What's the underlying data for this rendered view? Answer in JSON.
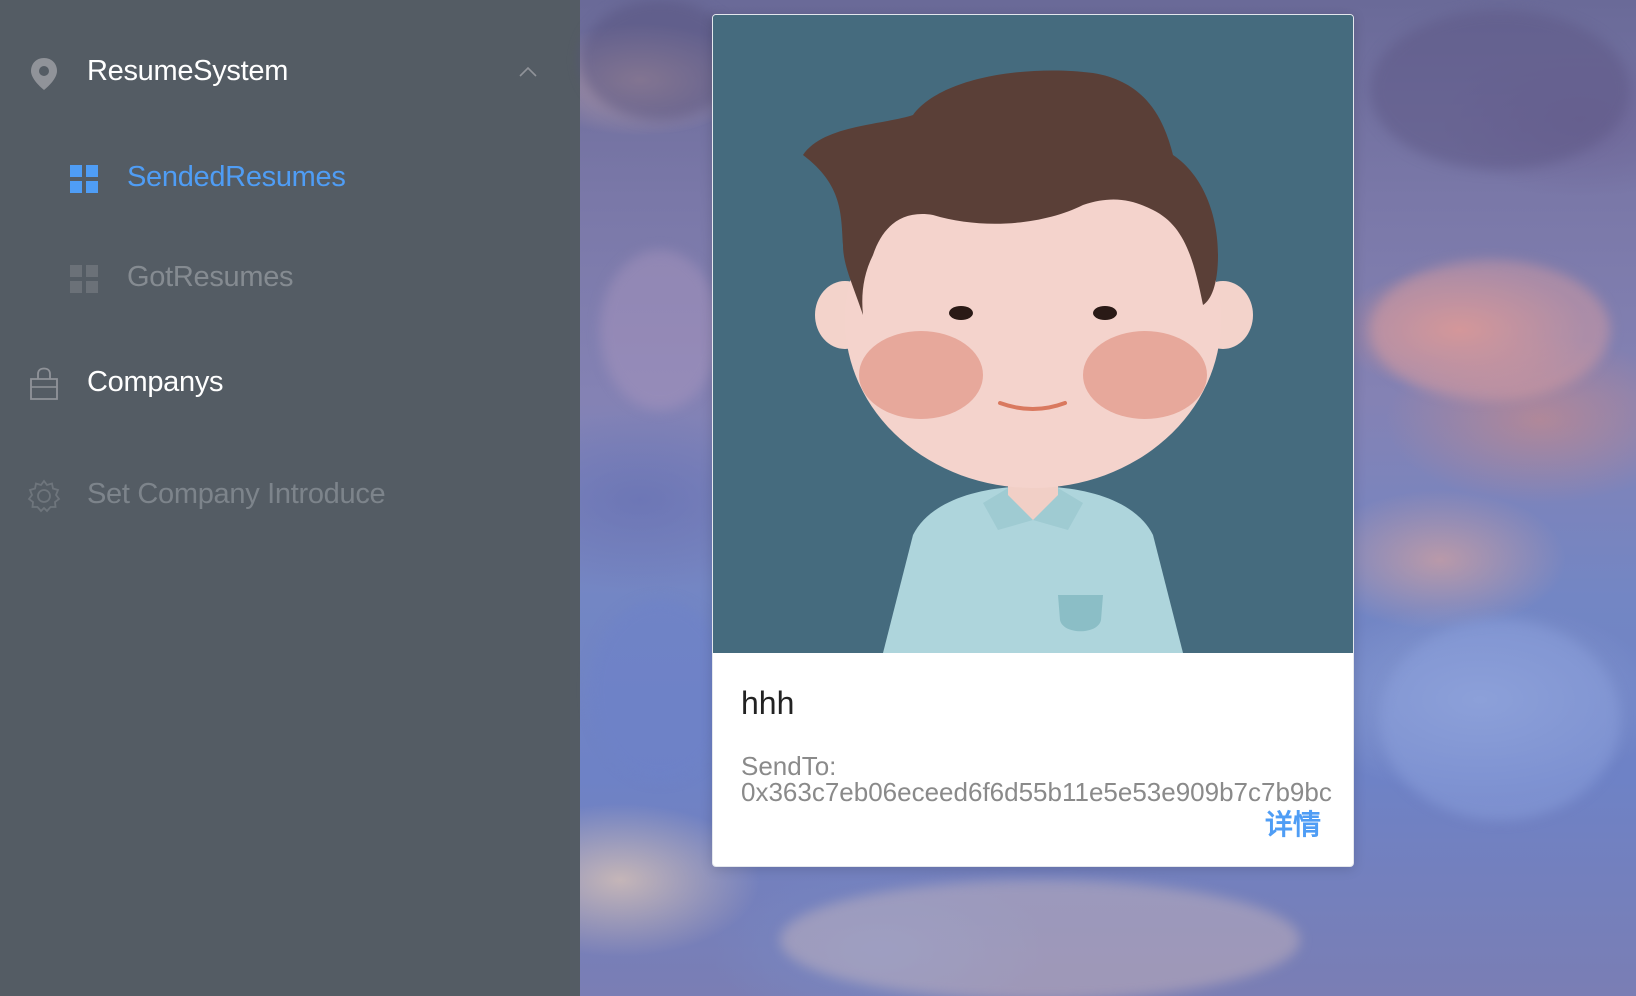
{
  "sidebar": {
    "background": "#545c64",
    "active_color": "#4f9df5",
    "menu": {
      "resume_system": {
        "label": "ResumeSystem",
        "icon": "location-pin-icon",
        "expanded": true
      },
      "sended_resumes": {
        "label": "SendedResumes",
        "icon": "grid-icon",
        "active": true
      },
      "got_resumes": {
        "label": "GotResumes",
        "icon": "grid-icon"
      },
      "companys": {
        "label": "Companys",
        "icon": "shopping-bag-icon"
      },
      "set_company_introduce": {
        "label": "Set Company Introduce",
        "icon": "gear-icon",
        "disabled": true
      }
    }
  },
  "card": {
    "name": "hhh",
    "sendto_label": "SendTo:",
    "sendto_address": "0x363c7eb06eceed6f6d55b11e5e53e909b7c7b9bc",
    "detail_label": "详情",
    "avatar_icon": "cartoon-boy-avatar"
  }
}
